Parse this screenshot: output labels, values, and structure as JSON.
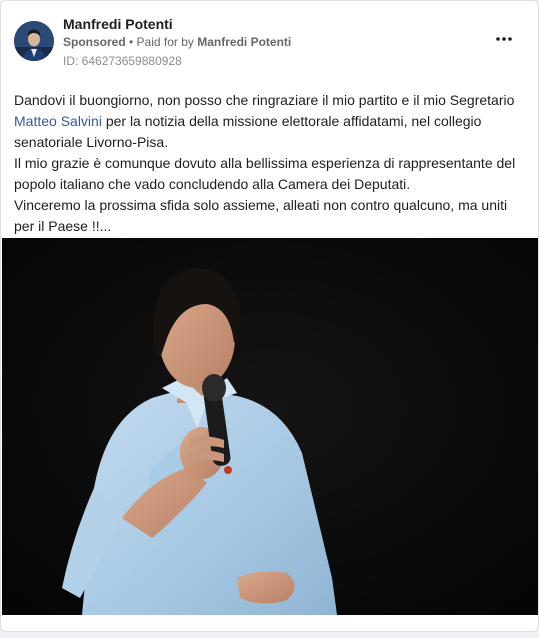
{
  "post": {
    "author_name": "Manfredi Potenti",
    "sponsored_label": "Sponsored",
    "paid_for_prefix": " • Paid for by ",
    "paid_for_name": "Manfredi Potenti",
    "ad_id": "ID: 646273659880928",
    "text": {
      "p1_before": "Dandovi il buongiorno, non posso che ringraziare il mio partito e il mio Segretario ",
      "p1_mention": "Matteo Salvini",
      "p1_after": " per la notizia della missione elettorale affidatami, nel collegio senatoriale Livorno-Pisa.",
      "p2": "Il mio grazie è comunque dovuto alla bellissima esperienza di rappresentante del popolo italiano che vado concludendo alla Camera dei Deputati.",
      "p3": "Vinceremo la prossima sfida solo assieme, alleati non contro qualcuno, ma uniti per il Paese !!..."
    }
  },
  "icons": {
    "more": "more-options-icon",
    "avatar": "avatar"
  },
  "colors": {
    "link": "#385898",
    "muted": "#65676b",
    "photo_background": "#080808",
    "shirt": "#a9cbe6"
  }
}
